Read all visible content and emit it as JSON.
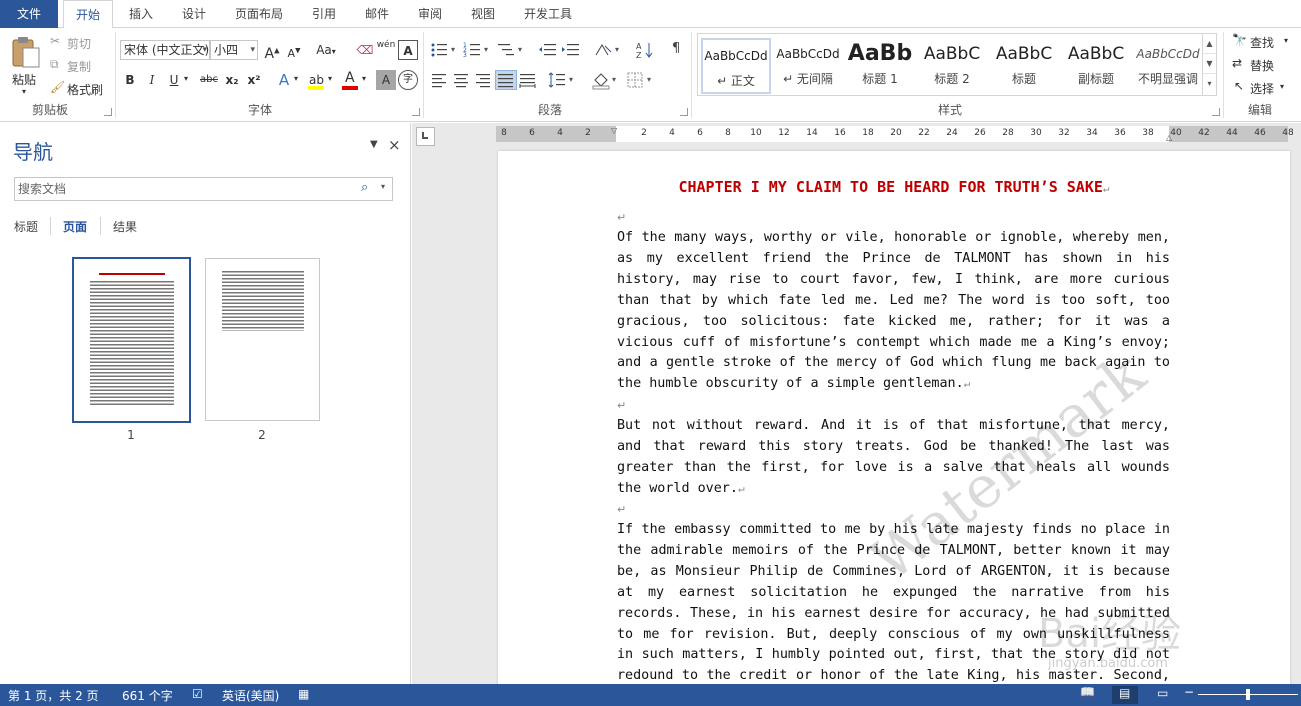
{
  "tabs": [
    {
      "label": "文件"
    },
    {
      "label": "开始"
    },
    {
      "label": "插入"
    },
    {
      "label": "设计"
    },
    {
      "label": "页面布局"
    },
    {
      "label": "引用"
    },
    {
      "label": "邮件"
    },
    {
      "label": "审阅"
    },
    {
      "label": "视图"
    },
    {
      "label": "开发工具"
    }
  ],
  "ribbon": {
    "clipboard": {
      "label": "剪贴板",
      "paste": "粘贴",
      "cut": "剪切",
      "copy": "复制",
      "format_painter": "格式刷"
    },
    "font": {
      "label": "字体",
      "font_name": "宋体 (中文正文)",
      "font_size": "小四",
      "change_case": "Aa",
      "bold": "B",
      "italic": "I",
      "underline": "U",
      "strike": "abc",
      "sub": "x₂",
      "sup": "x²",
      "effects": "A",
      "font_color": "A",
      "char_shade": "A",
      "enclose": "字",
      "phonetic": "wén"
    },
    "paragraph": {
      "label": "段落"
    },
    "styles": {
      "label": "样式",
      "items": [
        {
          "sample": "AaBbCcDd",
          "name": "↵ 正文"
        },
        {
          "sample": "AaBbCcDd",
          "name": "↵ 无间隔"
        },
        {
          "sample": "AaBb",
          "name": "标题 1"
        },
        {
          "sample": "AaBbC",
          "name": "标题 2"
        },
        {
          "sample": "AaBbC",
          "name": "标题"
        },
        {
          "sample": "AaBbC",
          "name": "副标题"
        },
        {
          "sample": "AaBbCcDd",
          "name": "不明显强调"
        }
      ]
    },
    "editing": {
      "label": "编辑",
      "find": "查找",
      "replace": "替换",
      "select": "选择"
    }
  },
  "nav": {
    "title": "导航",
    "search_placeholder": "搜索文档",
    "tabs": [
      "标题",
      "页面",
      "结果"
    ],
    "pages": [
      "1",
      "2"
    ]
  },
  "ruler": {
    "left": [
      "8",
      "6",
      "4",
      "2"
    ],
    "right": [
      "2",
      "4",
      "6",
      "8",
      "10",
      "12",
      "14",
      "16",
      "18",
      "20",
      "22",
      "24",
      "26",
      "28",
      "30",
      "32",
      "34",
      "36",
      "38",
      "40",
      "42",
      "44",
      "46",
      "48"
    ]
  },
  "document": {
    "chapter": "CHAPTER I MY CLAIM TO BE HEARD FOR TRUTH’S SAKE",
    "paragraphs": [
      "Of the many ways, worthy or vile, honorable or ignoble, whereby men, as my excellent friend the Prince de TALMONT has shown in his history, may rise to court favor, few, I think, are more curious than that by which fate led me. Led me? The word is too soft, too gracious, too solicitous: fate kicked me, rather; for it was a vicious cuff of misfortune’s contempt which made me a King’s envoy; and a gentle stroke of the mercy of God which flung me back again to the humble obscurity of a simple gentleman.",
      "But not without reward. And it is of that misfortune, that mercy, and that reward this story treats. God be thanked! The last was greater than the first, for love is a salve that heals all wounds the world over.",
      "If the embassy committed to me by his late majesty finds no place in the admirable memoirs of the Prince de TALMONT, better known it may be, as Monsieur Philip de Commines, Lord of ARGENTON, it is because at my earnest solicitation he expunged the narrative from his records. These, in his earnest desire for accuracy, he had submitted to me for revision. But, deeply conscious of my own unskillfulness in such matters, I humbly pointed out, first, that the story did not redound to the credit or honor of the late King, his master. Second, that the"
    ],
    "watermark": "Watermark",
    "watermark2": "Bai经验",
    "watermark3": "jingyan.baidu.com"
  },
  "status": {
    "page": "第 1 页，共 2 页",
    "words": "661 个字",
    "lang": "英语(美国)"
  }
}
